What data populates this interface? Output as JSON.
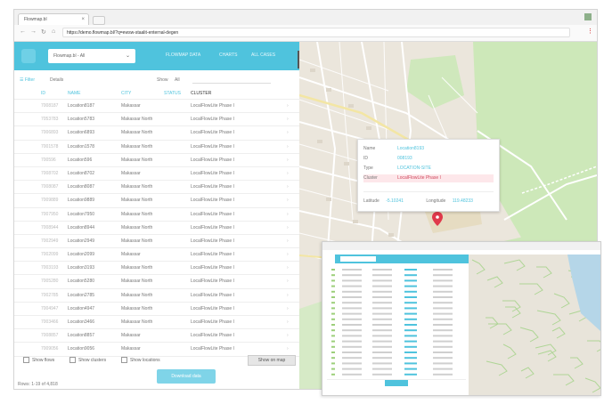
{
  "browser": {
    "tab_title": "Flowmap.bl",
    "close_symbol": "×",
    "url": "https://demo.flowmap.bl/?q=ewsw-staalit-enternal-degen"
  },
  "app": {
    "selector_value": "Flowmap.bl - All",
    "top_links": [
      "FLOWMAP DATA",
      "CHARTS",
      "ALL CASES"
    ],
    "toolbar": {
      "left_a": "Filter",
      "left_b": "Details",
      "rows_label": "Show",
      "rows_value": "All"
    },
    "columns": [
      "ID",
      "NAME",
      "CITY",
      "STATUS",
      "CLUSTER"
    ],
    "active_column_index": 4,
    "rows": [
      [
        "7008187",
        "Location8187",
        "Makassar",
        "",
        "LocalFlowLite Phase I"
      ],
      [
        "7053783",
        "Location5783",
        "Makassar North",
        "",
        "LocalFlowLite Phase I"
      ],
      [
        "7006893",
        "Location6893",
        "Makassar North",
        "",
        "LocalFlowLite Phase I"
      ],
      [
        "7001578",
        "Location1578",
        "Makassar North",
        "",
        "LocalFlowLite Phase I"
      ],
      [
        "700596",
        "Location596",
        "Makassar North",
        "",
        "LocalFlowLite Phase I"
      ],
      [
        "7008702",
        "Location8702",
        "Makassar",
        "",
        "LocalFlowLite Phase I"
      ],
      [
        "7008087",
        "Location8087",
        "Makassar North",
        "",
        "LocalFlowLite Phase I"
      ],
      [
        "7009889",
        "Location9889",
        "Makassar North",
        "",
        "LocalFlowLite Phase I"
      ],
      [
        "7007950",
        "Location7950",
        "Makassar North",
        "",
        "LocalFlowLite Phase I"
      ],
      [
        "7008944",
        "Location8944",
        "Makassar North",
        "",
        "LocalFlowLite Phase I"
      ],
      [
        "7002949",
        "Location2949",
        "Makassar North",
        "",
        "LocalFlowLite Phase I"
      ],
      [
        "7002099",
        "Location2099",
        "Makassar",
        "",
        "LocalFlowLite Phase I"
      ],
      [
        "7003193",
        "Location3193",
        "Makassar North",
        "",
        "LocalFlowLite Phase I"
      ],
      [
        "7005280",
        "Location5280",
        "Makassar North",
        "",
        "LocalFlowLite Phase I"
      ],
      [
        "7002785",
        "Location2785",
        "Makassar North",
        "",
        "LocalFlowLite Phase I"
      ],
      [
        "7004947",
        "Location4947",
        "Makassar North",
        "",
        "LocalFlowLite Phase I"
      ],
      [
        "7003466",
        "Location3466",
        "Makassar North",
        "",
        "LocalFlowLite Phase I"
      ],
      [
        "7008857",
        "Location8857",
        "Makassar",
        "",
        "LocalFlowLite Phase I"
      ],
      [
        "7009056",
        "Location9056",
        "Makassar",
        "",
        "LocalFlowLite Phase I"
      ]
    ],
    "checks": [
      "Show flows",
      "Show clusters",
      "Show locations"
    ],
    "show_button": "Show on map",
    "action_button": "Download data",
    "footer": "Rows: 1-19 of 4,818"
  },
  "popup": {
    "rows": [
      {
        "k": "Name",
        "v": "Location8193"
      },
      {
        "k": "ID",
        "v": "008193"
      },
      {
        "k": "Type",
        "v": "LOCATION-SITE"
      },
      {
        "k": "Cluster",
        "v": "LocalFlowLite Phase I"
      }
    ],
    "lat_label": "Latitude",
    "lat_value": "-5.10241",
    "lng_label": "Longitude",
    "lng_value": "119.48233"
  },
  "colors": {
    "accent": "#4fc3dd",
    "marker": "#e0394b",
    "map_bg": "#ece8df",
    "park": "#c8e6b4"
  }
}
